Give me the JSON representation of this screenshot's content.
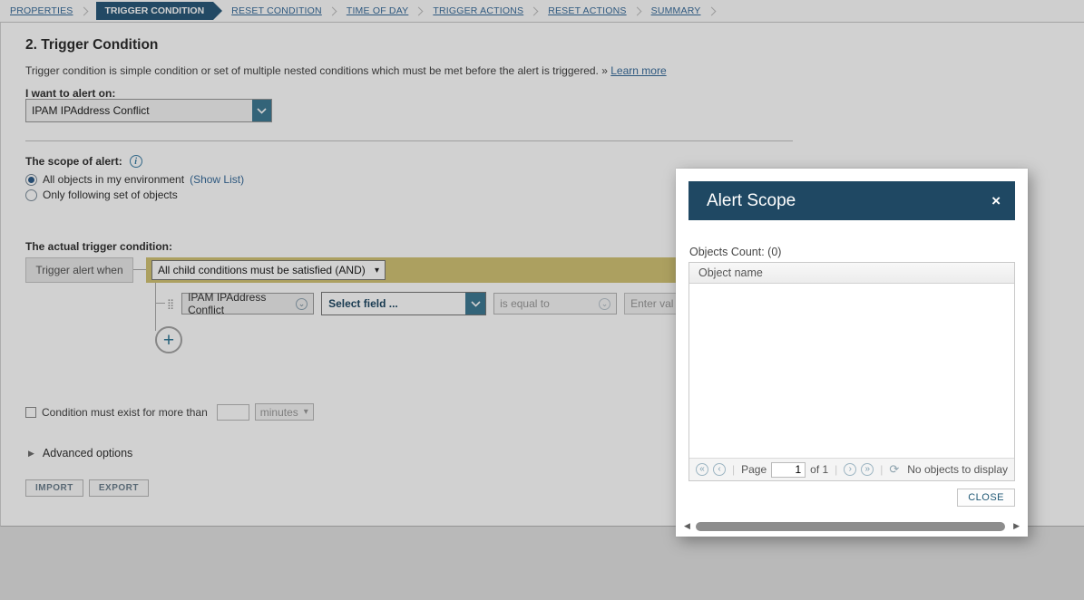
{
  "wizard": {
    "steps": [
      {
        "label": "PROPERTIES",
        "active": false
      },
      {
        "label": "TRIGGER CONDITION",
        "active": true
      },
      {
        "label": "RESET CONDITION",
        "active": false
      },
      {
        "label": "TIME OF DAY",
        "active": false
      },
      {
        "label": "TRIGGER ACTIONS",
        "active": false
      },
      {
        "label": "RESET ACTIONS",
        "active": false
      },
      {
        "label": "SUMMARY",
        "active": false
      }
    ]
  },
  "page": {
    "title": "2. Trigger Condition",
    "description": "Trigger condition is simple condition or set of multiple nested conditions which must be met before the alert is triggered.",
    "learn_more_prefix": "»",
    "learn_more": "Learn more"
  },
  "alert_on": {
    "label": "I want to alert on:",
    "value": "IPAM IPAddress Conflict"
  },
  "scope": {
    "label": "The scope of alert:",
    "options": [
      {
        "label": "All objects in my environment",
        "link": "(Show List)",
        "selected": true
      },
      {
        "label": "Only following set of objects",
        "link": "",
        "selected": false
      }
    ]
  },
  "trigger": {
    "label": "The actual trigger condition:",
    "when_label": "Trigger alert when",
    "logic_value": "All child conditions must be satisfied (AND)",
    "condition": {
      "object_value": "IPAM IPAddress Conflict",
      "field_placeholder": "Select field ...",
      "operator_value": "is equal to",
      "value_placeholder": "Enter val"
    }
  },
  "duration": {
    "label": "Condition must exist for more than",
    "value": "",
    "unit": "minutes"
  },
  "advanced": {
    "label": "Advanced options"
  },
  "footer_buttons": {
    "import": "IMPORT",
    "export": "EXPORT"
  },
  "modal": {
    "title": "Alert Scope",
    "objects_count": "Objects Count: (0)",
    "grid": {
      "column_header": "Object name"
    },
    "pager": {
      "page_label": "Page",
      "page_value": "1",
      "of_label": "of 1",
      "empty_text": "No objects to display"
    },
    "close_button": "CLOSE"
  },
  "icons": {
    "close": "×",
    "select_caret": "▾",
    "circle_chevron": "⌄",
    "info": "i",
    "plus": "+",
    "drag_handle": "⣿",
    "advanced_arrow": "▶",
    "first_page": "«",
    "prev_page": "‹",
    "next_page": "›",
    "last_page": "»",
    "refresh": "⟳",
    "scroll_left": "◀",
    "scroll_right": "▶"
  },
  "colors": {
    "accent_teal": "#3f7a94",
    "khaki_bar": "#d2c476",
    "modal_header": "#1f4863",
    "active_step": "#2a5a7a",
    "link_blue": "#3a6d9c"
  }
}
